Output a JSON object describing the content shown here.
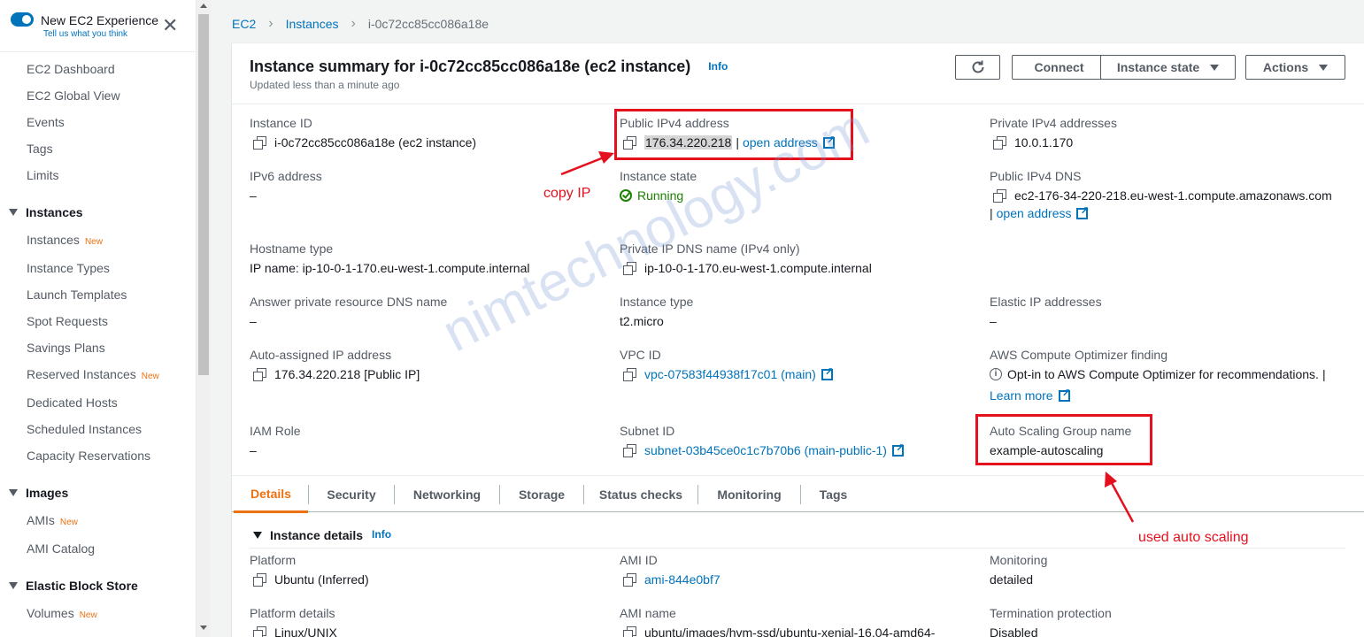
{
  "sidebar": {
    "toggle_title": "New EC2 Experience",
    "toggle_sub": "Tell us what you think",
    "top_items": [
      "EC2 Dashboard",
      "EC2 Global View",
      "Events",
      "Tags",
      "Limits"
    ],
    "sections": {
      "instances": {
        "title": "Instances",
        "items": [
          "Instances",
          "Instance Types",
          "Launch Templates",
          "Spot Requests",
          "Savings Plans",
          "Reserved Instances",
          "Dedicated Hosts",
          "Scheduled Instances",
          "Capacity Reservations"
        ]
      },
      "images": {
        "title": "Images",
        "items": [
          "AMIs",
          "AMI Catalog"
        ]
      },
      "ebs": {
        "title": "Elastic Block Store",
        "items": [
          "Volumes"
        ]
      }
    },
    "new_badge": "New"
  },
  "breadcrumb": [
    "EC2",
    "Instances",
    "i-0c72cc85cc086a18e"
  ],
  "header": {
    "title": "Instance summary for i-0c72cc85cc086a18e (ec2 instance)",
    "info": "Info",
    "subtitle": "Updated less than a minute ago",
    "refresh_icon": "refresh-icon",
    "connect": "Connect",
    "instance_state": "Instance state",
    "actions": "Actions"
  },
  "fields": {
    "instance_id": {
      "label": "Instance ID",
      "value": "i-0c72cc85cc086a18e (ec2 instance)"
    },
    "public_ipv4": {
      "label": "Public IPv4 address",
      "value": "176.34.220.218",
      "sep": "|",
      "link": "open address"
    },
    "private_ipv4": {
      "label": "Private IPv4 addresses",
      "value": "10.0.1.170"
    },
    "ipv6": {
      "label": "IPv6 address",
      "value": "–"
    },
    "instance_state": {
      "label": "Instance state",
      "value": "Running"
    },
    "public_dns": {
      "label": "Public IPv4 DNS",
      "value": "ec2-176-34-220-218.eu-west-1.compute.amazonaws.com",
      "sep": "|",
      "link": "open address"
    },
    "hostname_type": {
      "label": "Hostname type",
      "value": "IP name: ip-10-0-1-170.eu-west-1.compute.internal"
    },
    "private_dns": {
      "label": "Private IP DNS name (IPv4 only)",
      "value": "ip-10-0-1-170.eu-west-1.compute.internal"
    },
    "answer_dns": {
      "label": "Answer private resource DNS name",
      "value": "–"
    },
    "instance_type": {
      "label": "Instance type",
      "value": "t2.micro"
    },
    "elastic_ip": {
      "label": "Elastic IP addresses",
      "value": "–"
    },
    "auto_ip": {
      "label": "Auto-assigned IP address",
      "value": "176.34.220.218 [Public IP]"
    },
    "vpc_id": {
      "label": "VPC ID",
      "value": "vpc-07583f44938f17c01 (main)"
    },
    "optimizer": {
      "label": "AWS Compute Optimizer finding",
      "value": "Opt-in to AWS Compute Optimizer for recommendations.",
      "sep": "|",
      "link": "Learn more"
    },
    "iam_role": {
      "label": "IAM Role",
      "value": "–"
    },
    "subnet_id": {
      "label": "Subnet ID",
      "value": "subnet-03b45ce0c1c7b70b6 (main-public-1)"
    },
    "asg_name": {
      "label": "Auto Scaling Group name",
      "value": "example-autoscaling"
    }
  },
  "tabs": [
    "Details",
    "Security",
    "Networking",
    "Storage",
    "Status checks",
    "Monitoring",
    "Tags"
  ],
  "details": {
    "title": "Instance details",
    "info": "Info",
    "platform": {
      "label": "Platform",
      "value": "Ubuntu (Inferred)"
    },
    "ami_id": {
      "label": "AMI ID",
      "value": "ami-844e0bf7"
    },
    "monitoring": {
      "label": "Monitoring",
      "value": "detailed"
    },
    "platform_details": {
      "label": "Platform details",
      "value": "Linux/UNIX"
    },
    "ami_name": {
      "label": "AMI name",
      "value": "ubuntu/images/hvm-ssd/ubuntu-xenial-16.04-amd64-"
    },
    "termination": {
      "label": "Termination protection",
      "value": "Disabled"
    }
  },
  "annotations": {
    "copy_ip": "copy IP",
    "used_auto_scaling": "used auto scaling",
    "watermark": "nimtechnology.com"
  },
  "colors": {
    "accent": "#ec7211",
    "link": "#0073bb",
    "success": "#1d8102",
    "annotation": "#e5101d"
  }
}
